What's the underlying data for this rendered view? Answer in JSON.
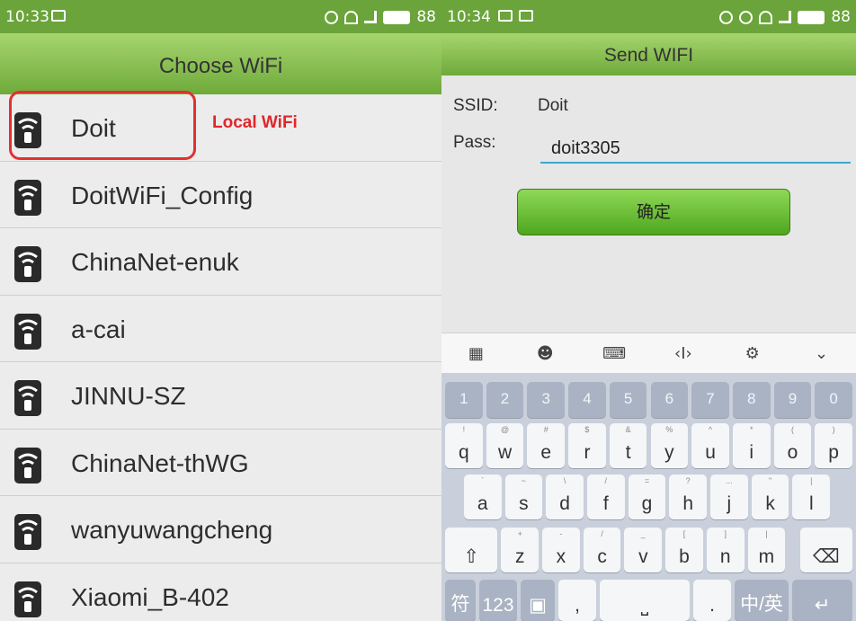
{
  "left": {
    "status": {
      "time": "10:33",
      "battery": "88"
    },
    "title": "Choose WiFi",
    "annotation": "Local WiFi",
    "networks": [
      {
        "name": "Doit"
      },
      {
        "name": "DoitWiFi_Config"
      },
      {
        "name": "ChinaNet-enuk"
      },
      {
        "name": "a-cai"
      },
      {
        "name": "JINNU-SZ"
      },
      {
        "name": "ChinaNet-thWG"
      },
      {
        "name": "wanyuwangcheng"
      },
      {
        "name": "Xiaomi_B-402"
      }
    ]
  },
  "right": {
    "status": {
      "time": "10:34",
      "battery": "88"
    },
    "title": "Send WIFI",
    "ssid_label": "SSID:",
    "ssid_value": "Doit",
    "pass_label": "Pass:",
    "pass_value": "doit3305",
    "confirm_label": "确定"
  },
  "keyboard": {
    "numbers": [
      "1",
      "2",
      "3",
      "4",
      "5",
      "6",
      "7",
      "8",
      "9",
      "0"
    ],
    "row1": [
      [
        "q",
        "!"
      ],
      [
        "w",
        "@"
      ],
      [
        "e",
        "#"
      ],
      [
        "r",
        "$"
      ],
      [
        "t",
        "&"
      ],
      [
        "y",
        "%"
      ],
      [
        "u",
        "^"
      ],
      [
        "i",
        "*"
      ],
      [
        "o",
        "("
      ],
      [
        "p",
        ")"
      ]
    ],
    "row2": [
      [
        "a",
        "`"
      ],
      [
        "s",
        "~"
      ],
      [
        "d",
        "\\"
      ],
      [
        "f",
        "/"
      ],
      [
        "g",
        "="
      ],
      [
        "h",
        "?"
      ],
      [
        "j",
        "..."
      ],
      [
        "k",
        "\""
      ],
      [
        "l",
        "|"
      ]
    ],
    "row3": [
      [
        "z",
        "+"
      ],
      [
        "x",
        "-"
      ],
      [
        "c",
        "/"
      ],
      [
        "v",
        "_"
      ],
      [
        "b",
        "["
      ],
      [
        "n",
        "]"
      ],
      [
        "m",
        "|"
      ]
    ],
    "bottom": {
      "symbol": "符",
      "num": "123",
      "comma": ",",
      "period": ".",
      "lang": "中/英"
    }
  }
}
